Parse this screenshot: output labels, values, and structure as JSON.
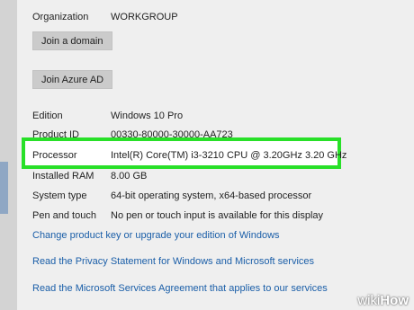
{
  "system": {
    "organization": {
      "label": "Organization",
      "value": "WORKGROUP"
    },
    "join_domain_label": "Join a domain",
    "join_azure_label": "Join Azure AD",
    "edition": {
      "label": "Edition",
      "value": "Windows 10 Pro"
    },
    "product_id": {
      "label": "Product ID",
      "value": "00330-80000-30000-AA723"
    },
    "processor": {
      "label": "Processor",
      "value": "Intel(R) Core(TM) i3-3210 CPU @ 3.20GHz   3.20 GHz"
    },
    "ram": {
      "label": "Installed RAM",
      "value": "8.00 GB"
    },
    "system_type": {
      "label": "System type",
      "value": "64-bit operating system, x64-based processor"
    },
    "pen_touch": {
      "label": "Pen and touch",
      "value": "No pen or touch input is available for this display"
    }
  },
  "links": {
    "change_key": "Change product key or upgrade your edition of Windows",
    "privacy": "Read the Privacy Statement for Windows and Microsoft services",
    "agreement": "Read the Microsoft Services Agreement that applies to our services"
  },
  "watermark": {
    "part1": "wiki",
    "part2": "How"
  },
  "colors": {
    "highlight": "#28e028",
    "link": "#1a5ea8"
  }
}
